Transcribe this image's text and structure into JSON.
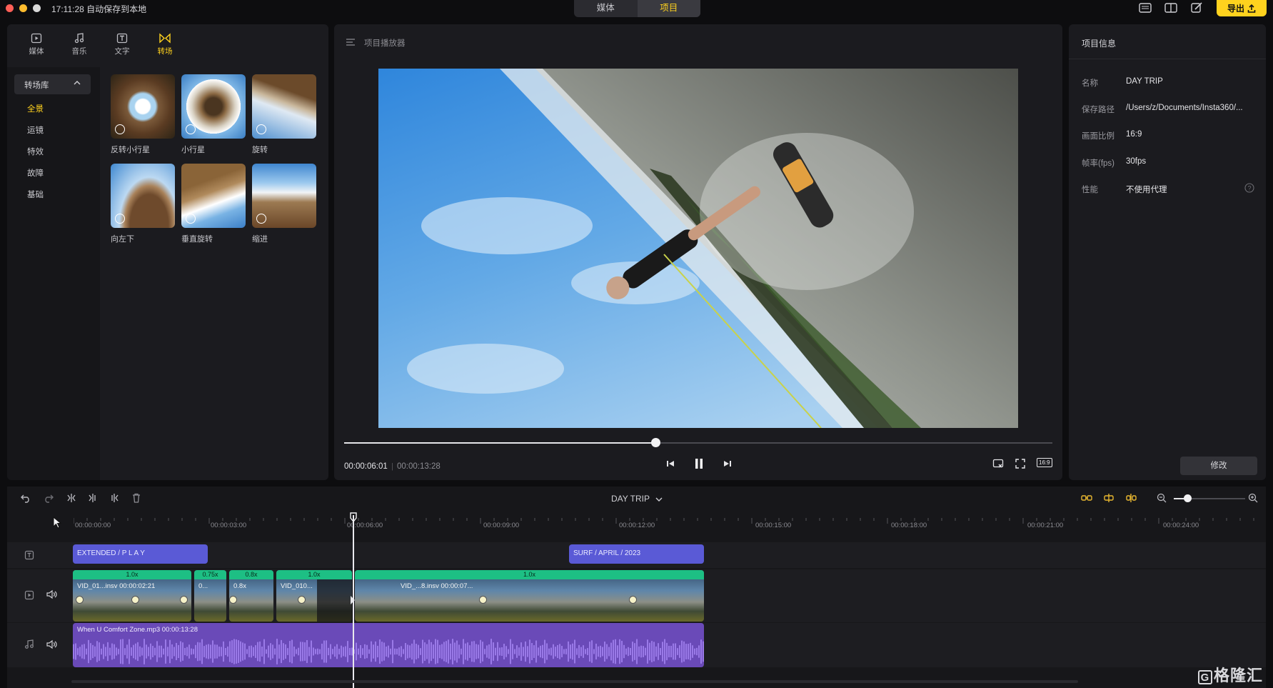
{
  "titlebar": {
    "autosave_text": "17:11:28 自动保存到本地",
    "tabs": [
      {
        "label": "媒体"
      },
      {
        "label": "项目"
      }
    ],
    "export_label": "导出"
  },
  "left_panel": {
    "tool_tabs": [
      {
        "label": "媒体"
      },
      {
        "label": "音乐"
      },
      {
        "label": "文字"
      },
      {
        "label": "转场"
      }
    ],
    "library_title": "转场库",
    "categories": [
      {
        "label": "全景"
      },
      {
        "label": "运镜"
      },
      {
        "label": "特效"
      },
      {
        "label": "故障"
      },
      {
        "label": "基础"
      }
    ],
    "transitions": [
      {
        "label": "反转小行星"
      },
      {
        "label": "小行星"
      },
      {
        "label": "旋转"
      },
      {
        "label": "向左下"
      },
      {
        "label": "垂直旋转"
      },
      {
        "label": "缩进"
      }
    ]
  },
  "preview": {
    "title": "项目播放器",
    "time_current": "00:00:06:01",
    "time_total": "00:00:13:28",
    "progress": 0.44,
    "aspect_label": "16:9"
  },
  "info": {
    "title": "项目信息",
    "rows": [
      {
        "key": "名称",
        "value": "DAY TRIP"
      },
      {
        "key": "保存路径",
        "value": "/Users/z/Documents/Insta360/..."
      },
      {
        "key": "画面比例",
        "value": "16:9"
      },
      {
        "key": "帧率(fps)",
        "value": "30fps"
      },
      {
        "key": "性能",
        "value": "不使用代理"
      }
    ],
    "modify_label": "修改"
  },
  "timeline": {
    "project_name": "DAY TRIP",
    "ticks": [
      "00:00:00:00",
      "00:00:03:00",
      "00:00:06:00",
      "00:00:09:00",
      "00:00:12:00",
      "00:00:15:00",
      "00:00:18:00",
      "00:00:21:00",
      "00:00:24:00"
    ],
    "title_clips": [
      {
        "label": "EXTENDED / P L A Y"
      },
      {
        "label": "SURF / APRIL / 2023"
      }
    ],
    "video_clips": [
      {
        "speed": "1.0x",
        "name": "VID_01...insv  00:00:02:21"
      },
      {
        "speed": "0.75x",
        "name": "0..."
      },
      {
        "speed": "0.8x",
        "name": "0.8x"
      },
      {
        "speed": "1.0x",
        "name": "VID_010..."
      },
      {
        "speed": "1.0x",
        "name": "VID_...8.insv  00:00:07..."
      }
    ],
    "audio_clip": {
      "label": "When U Comfort Zone.mp3   00:00:13:28"
    }
  },
  "watermark": "格隆汇"
}
